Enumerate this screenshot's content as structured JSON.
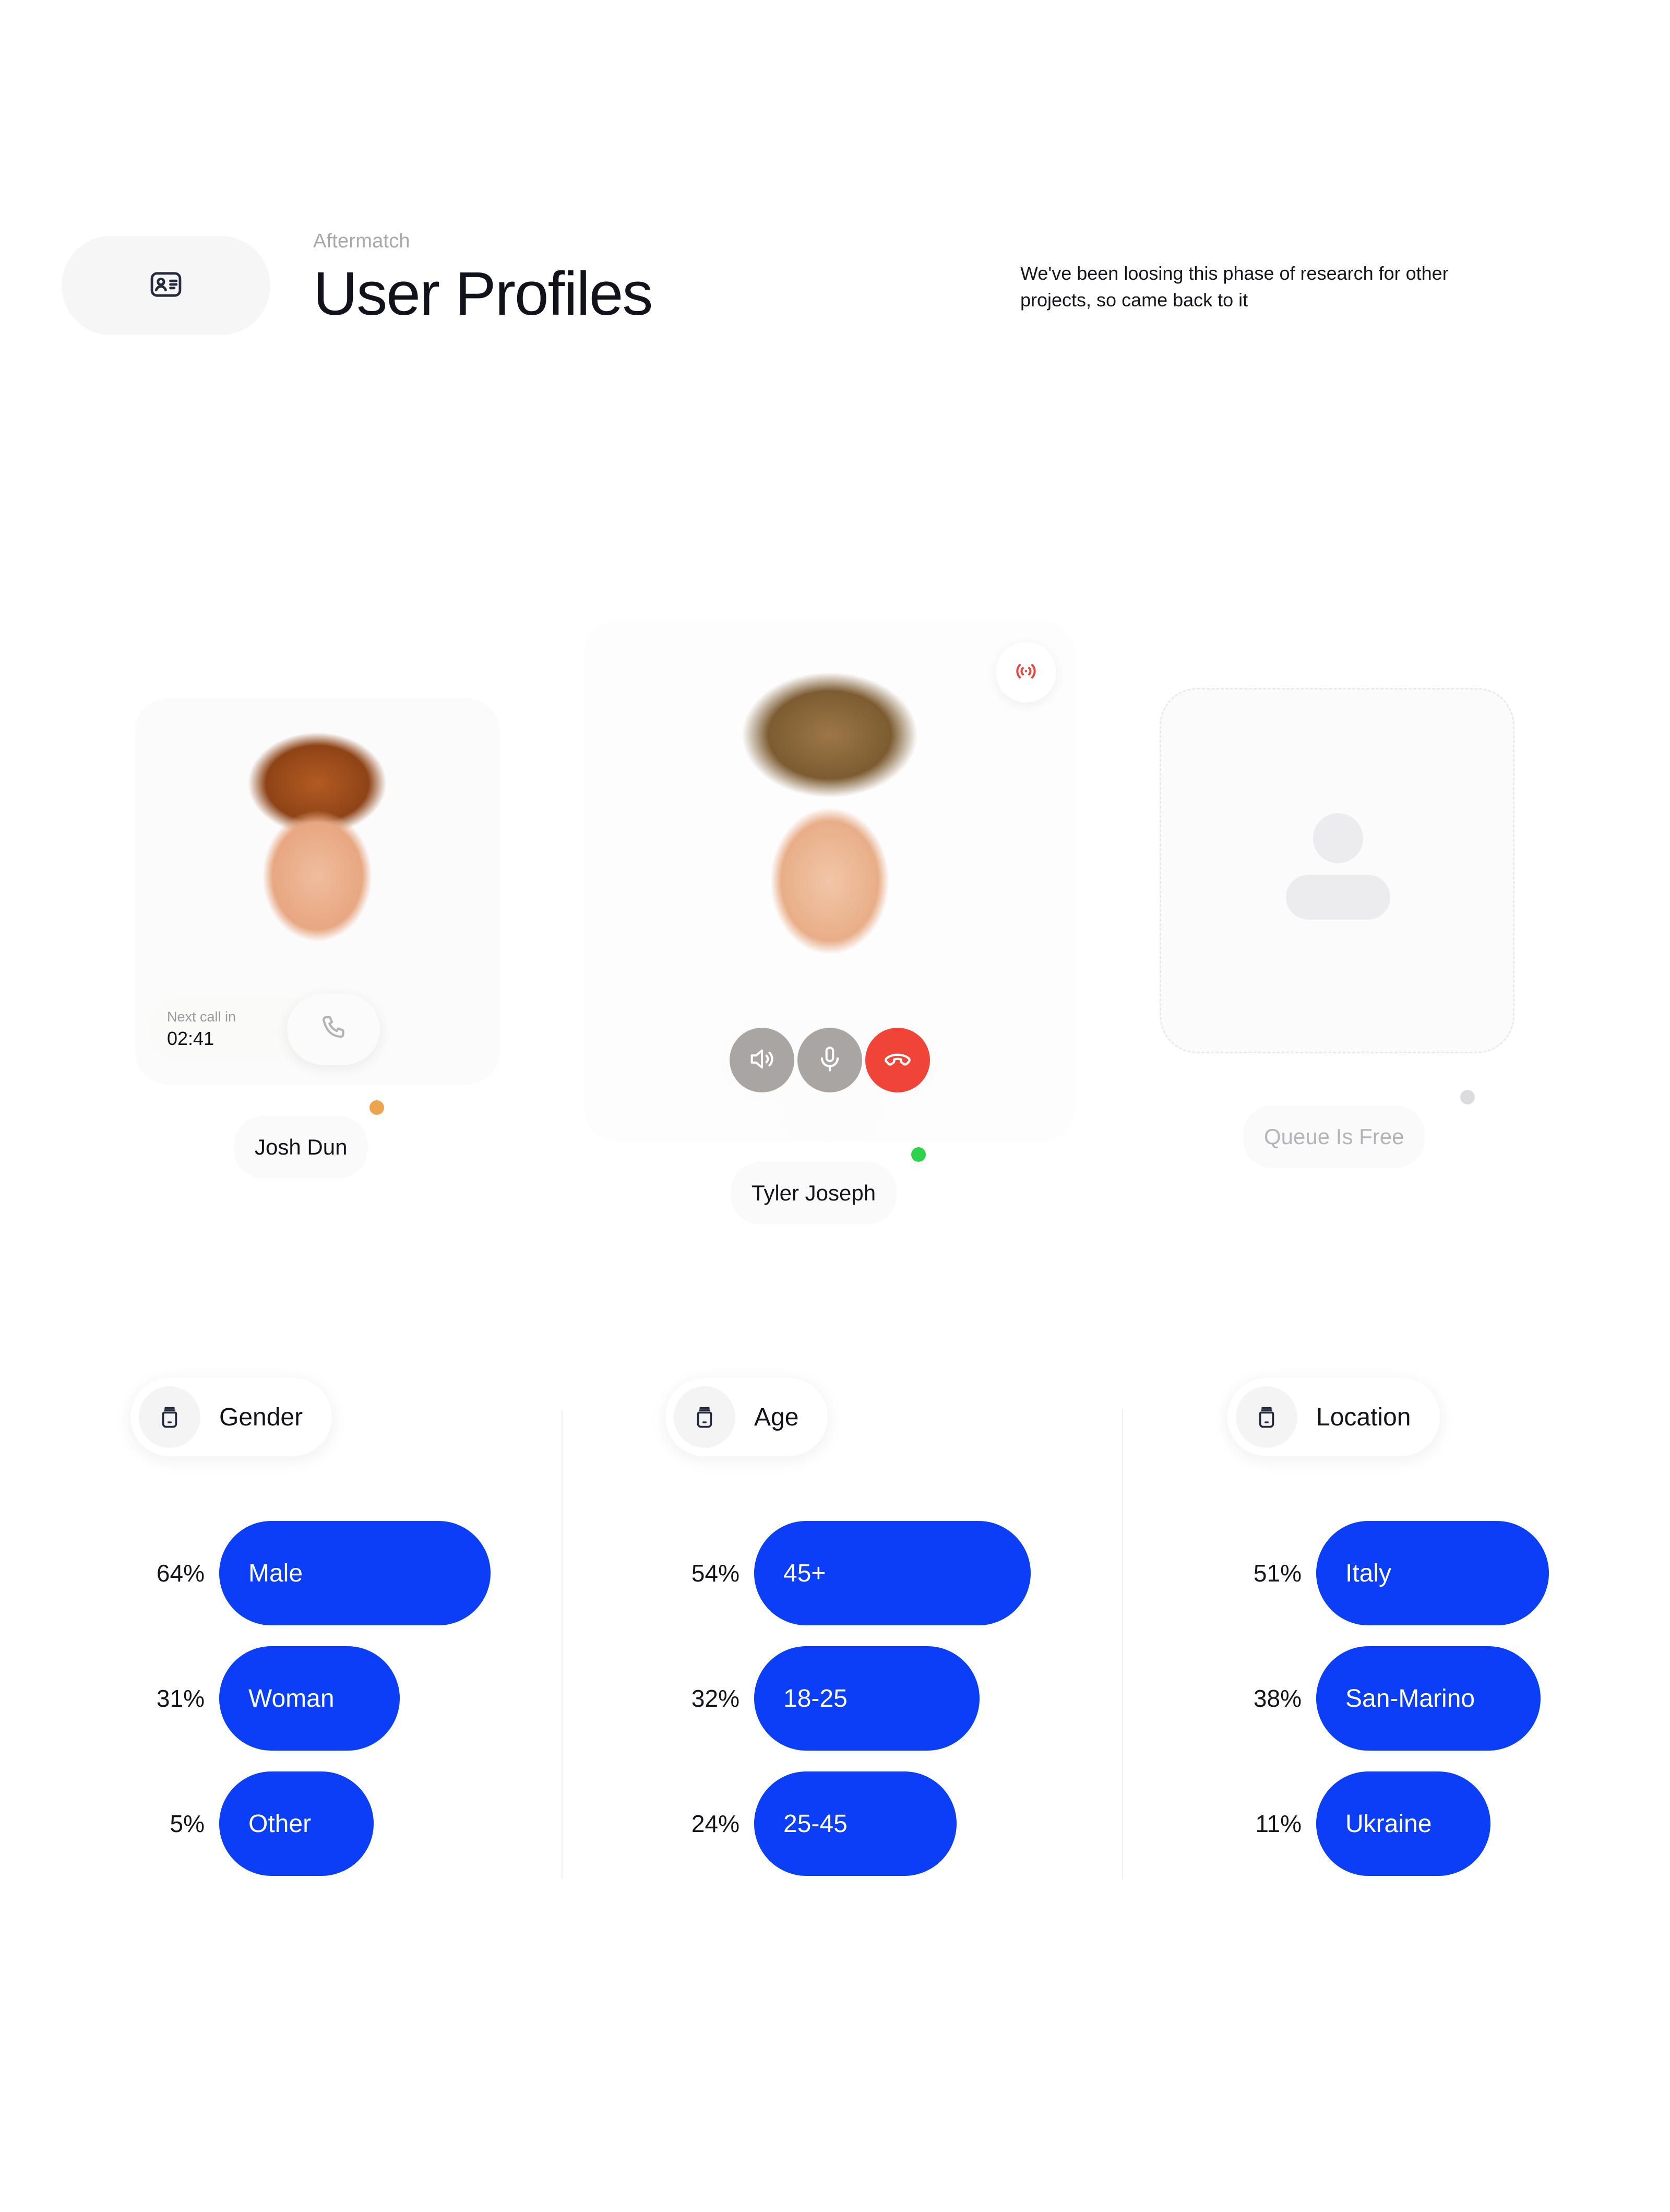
{
  "header": {
    "eyebrow": "Aftermatch",
    "title": "User Profiles",
    "description": "We've been loosing this phase of research for other projects, so came back to it",
    "icon": "contact-card-icon"
  },
  "call_cards": [
    {
      "name": "Josh Dun",
      "status_color": "#eda44e",
      "status": "away",
      "next_call_label": "Next call in",
      "next_call_time": "02:41",
      "call_button_icon": "phone-icon"
    },
    {
      "name": "Tyler Joseph",
      "status_color": "#2cd44b",
      "status": "online",
      "live_icon": "broadcast-icon",
      "controls": [
        {
          "name": "speaker",
          "icon": "speaker-icon",
          "color": "#a8a5a3"
        },
        {
          "name": "microphone",
          "icon": "microphone-icon",
          "color": "#a8a5a3"
        },
        {
          "name": "hang-up",
          "icon": "phone-hangup-icon",
          "color": "#f04438"
        }
      ]
    },
    {
      "name": "Queue Is Free",
      "status_color": "#dcdcde",
      "status": "empty",
      "placeholder_icon": "person-placeholder-icon"
    }
  ],
  "accent_color": "#0b3ef7",
  "chart_data": [
    {
      "type": "bar",
      "title": "Gender",
      "icon": "jar-icon",
      "categories": [
        "Male",
        "Woman",
        "Other"
      ],
      "values": [
        64,
        31,
        5
      ],
      "value_labels": [
        "64%",
        "31%",
        "5%"
      ],
      "xlabel": "",
      "ylabel": "",
      "xlim": [
        0,
        100
      ],
      "orientation": "horizontal",
      "grid": false,
      "legend": "none",
      "color": "#0b3ef7"
    },
    {
      "type": "bar",
      "title": "Age",
      "icon": "jar-icon",
      "categories": [
        "45+",
        "18-25",
        "25-45"
      ],
      "values": [
        54,
        32,
        24
      ],
      "value_labels": [
        "54%",
        "32%",
        "24%"
      ],
      "xlabel": "",
      "ylabel": "",
      "xlim": [
        0,
        100
      ],
      "orientation": "horizontal",
      "grid": false,
      "legend": "none",
      "color": "#0b3ef7"
    },
    {
      "type": "bar",
      "title": "Location",
      "icon": "jar-icon",
      "categories": [
        "Italy",
        "San-Marino",
        "Ukraine"
      ],
      "values": [
        51,
        38,
        11
      ],
      "value_labels": [
        "51%",
        "38%",
        "11%"
      ],
      "xlabel": "",
      "ylabel": "",
      "xlim": [
        0,
        100
      ],
      "orientation": "horizontal",
      "grid": false,
      "legend": "none",
      "color": "#0b3ef7"
    }
  ]
}
